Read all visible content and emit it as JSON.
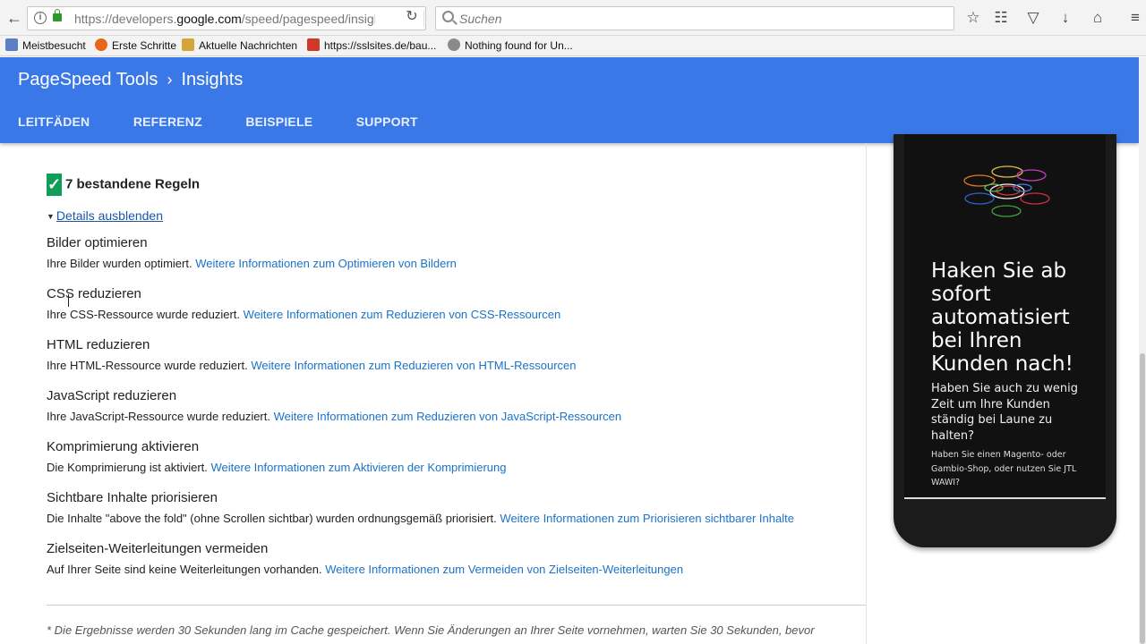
{
  "browser": {
    "url_prefix": "https://developers.",
    "url_domain": "google.com",
    "url_rest": "/speed/pagespeed/insigh",
    "search_placeholder": "Suchen"
  },
  "bookmarks": [
    {
      "label": "Meistbesucht"
    },
    {
      "label": "Erste Schritte"
    },
    {
      "label": "Aktuelle Nachrichten"
    },
    {
      "label": "https://sslsites.de/bau..."
    },
    {
      "label": "Nothing found for Un..."
    }
  ],
  "header": {
    "crumb1": "PageSpeed Tools",
    "crumb2": "Insights",
    "tabs": [
      "LEITFÄDEN",
      "REFERENZ",
      "BEISPIELE",
      "SUPPORT"
    ]
  },
  "summary": {
    "passed_label": "7 bestandene Regeln",
    "details_link": "Details ausblenden"
  },
  "rules": [
    {
      "title": "Bilder optimieren",
      "text": "Ihre Bilder wurden optimiert.",
      "link": "Weitere Informationen zum Optimieren von Bildern"
    },
    {
      "title": "CSS reduzieren",
      "text": "Ihre CSS-Ressource wurde reduziert.",
      "link": "Weitere Informationen zum Reduzieren von CSS-Ressourcen"
    },
    {
      "title": "HTML reduzieren",
      "text": "Ihre HTML-Ressource wurde reduziert.",
      "link": "Weitere Informationen zum Reduzieren von HTML-Ressourcen"
    },
    {
      "title": "JavaScript reduzieren",
      "text": "Ihre JavaScript-Ressource wurde reduziert.",
      "link": "Weitere Informationen zum Reduzieren von JavaScript-Ressourcen"
    },
    {
      "title": "Komprimierung aktivieren",
      "text": "Die Komprimierung ist aktiviert.",
      "link": "Weitere Informationen zum Aktivieren der Komprimierung"
    },
    {
      "title": "Sichtbare Inhalte priorisieren",
      "text": "Die Inhalte \"above the fold\" (ohne Scrollen sichtbar) wurden ordnungsgemäß priorisiert.",
      "link": "Weitere Informationen zum Priorisieren sichtbarer Inhalte"
    },
    {
      "title": "Zielseiten-Weiterleitungen vermeiden",
      "text": "Auf Ihrer Seite sind keine Weiterleitungen vorhanden.",
      "link": "Weitere Informationen zum Vermeiden von Zielseiten-Weiterleitungen"
    }
  ],
  "footnote": "* Die Ergebnisse werden 30 Sekunden lang im Cache gespeichert. Wenn Sie Änderungen an Ihrer Seite vornehmen, warten Sie 30 Sekunden, bevor",
  "phone": {
    "headline": "Haken Sie ab sofort automatisiert bei Ihren Kunden nach!",
    "subline": "Haben Sie auch zu wenig Zeit um Ihre Kunden ständig bei Laune zu halten?",
    "small": "Haben Sie einen Magento- oder Gambio-Shop, oder nutzen Sie JTL WAWI?"
  },
  "colors": {
    "header_bg": "#3b78e7",
    "link": "#1a73c8",
    "check": "#0f9d58"
  }
}
